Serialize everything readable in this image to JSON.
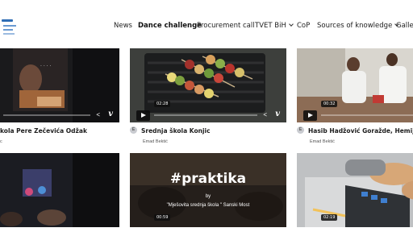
{
  "nav": {
    "items": [
      {
        "label": "News",
        "active": false
      },
      {
        "label": "Dance challenge",
        "active": true
      },
      {
        "label": "Procurement call",
        "active": false
      },
      {
        "label": "TVET BiH",
        "active": false,
        "dropdown": true
      },
      {
        "label": "CoP",
        "active": false
      },
      {
        "label": "Sources of knowledge",
        "active": false,
        "dropdown": true
      },
      {
        "label": "Galler",
        "active": false
      }
    ]
  },
  "cards": [
    {
      "title": "kola Pere Zečevića Odžak",
      "author": "c",
      "duration": "",
      "avatar": ""
    },
    {
      "title": "Srednja škola Konjic",
      "author": "Emad Bektić",
      "duration": "02:28",
      "avatar": "E"
    },
    {
      "title": "Hasib Hadžović Goražde, Hemijski sm",
      "author": "Emad Bektić",
      "duration": "00:32",
      "avatar": "E"
    },
    {
      "title": "",
      "author": "",
      "duration": "",
      "avatar": ""
    },
    {
      "title": "",
      "author": "",
      "duration": "00:59",
      "avatar": "",
      "overlay_title": "#praktika",
      "overlay_by": "by",
      "overlay_school": "\"Mješovita srednja škola \" Sanski Most"
    },
    {
      "title": "",
      "author": "",
      "duration": "02:19",
      "avatar": ""
    }
  ],
  "icons": {
    "play": "play-icon",
    "share": "share-icon",
    "vimeo": "vimeo-logo-icon"
  },
  "colors": {
    "nav_text": "#222222",
    "logo_blue": "#2f6db5",
    "thumb_overlay": "#0f0f0f"
  }
}
